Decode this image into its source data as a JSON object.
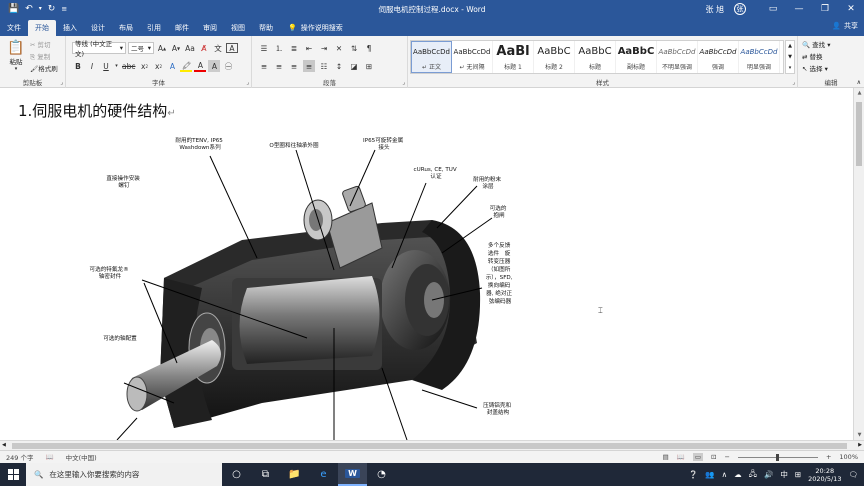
{
  "window": {
    "title": "伺服电机控制过程.docx  -  Word",
    "user": "张 旭",
    "user_initial": "张"
  },
  "tabs": [
    "文件",
    "开始",
    "插入",
    "设计",
    "布局",
    "引用",
    "邮件",
    "审阅",
    "视图",
    "帮助"
  ],
  "active_tab": "开始",
  "tell_me": "操作说明搜索",
  "share_label": "共享",
  "ribbon": {
    "clipboard": {
      "label": "剪贴板",
      "paste": "粘贴",
      "cut": "剪切",
      "copy": "复制",
      "format_painter": "格式刷"
    },
    "font": {
      "label": "字体",
      "font_name": "等线 (中文正文)",
      "font_size": "二号"
    },
    "paragraph": {
      "label": "段落"
    },
    "styles": {
      "label": "样式",
      "items": [
        {
          "sample": "AaBbCcDd",
          "name": "↵ 正文"
        },
        {
          "sample": "AaBbCcDd",
          "name": "↵ 无间隔"
        },
        {
          "sample": "AaBl",
          "name": "标题 1"
        },
        {
          "sample": "AaBbC",
          "name": "标题 2"
        },
        {
          "sample": "AaBbC",
          "name": "标题"
        },
        {
          "sample": "AaBbC",
          "name": "副标题"
        },
        {
          "sample": "AaBbCcDd",
          "name": "不明显强调"
        },
        {
          "sample": "AaBbCcDd",
          "name": "强调"
        },
        {
          "sample": "AaBbCcDd",
          "name": "明显强调"
        }
      ]
    },
    "editing": {
      "label": "编辑",
      "find": "查找",
      "replace": "替换",
      "select": "选择"
    }
  },
  "document": {
    "heading": "1.伺服电机的硬件结构",
    "figure_labels": {
      "l1": [
        "耐用的TENV, IP65",
        "Washdown系列"
      ],
      "l2": [
        "O型圈和往轴承外圈"
      ],
      "l3": [
        "IP65可旋转金属",
        "接头"
      ],
      "l4": [
        "cURus, CE, TUV",
        "认证"
      ],
      "l5": [
        "耐用的粉末",
        "涂层"
      ],
      "l6": [
        "可选的",
        "抱闸"
      ],
      "l7": [
        "直接操作安装",
        "螺钉"
      ],
      "l8": [
        "多个反馈",
        "选件　旋",
        "转变压器",
        "（如图所",
        "示），SFD,",
        "换向编码",
        "器, 绝对正",
        "弦编码器"
      ],
      "l9": [
        "可选的特氟龙®",
        "轴密封件"
      ],
      "l10": [
        "可选的轴配置"
      ],
      "l11": [
        "压铸铝壳和",
        "封盖结构"
      ]
    }
  },
  "status": {
    "word_count": "249 个字",
    "language": "中文(中国)",
    "zoom": "100%"
  },
  "taskbar": {
    "search_placeholder": "在这里输入你要搜索的内容",
    "ime": "中",
    "time": "20:28",
    "date": "2020/5/13"
  },
  "colors": {
    "word_blue": "#2b579a",
    "taskbar": "#1f2838"
  }
}
